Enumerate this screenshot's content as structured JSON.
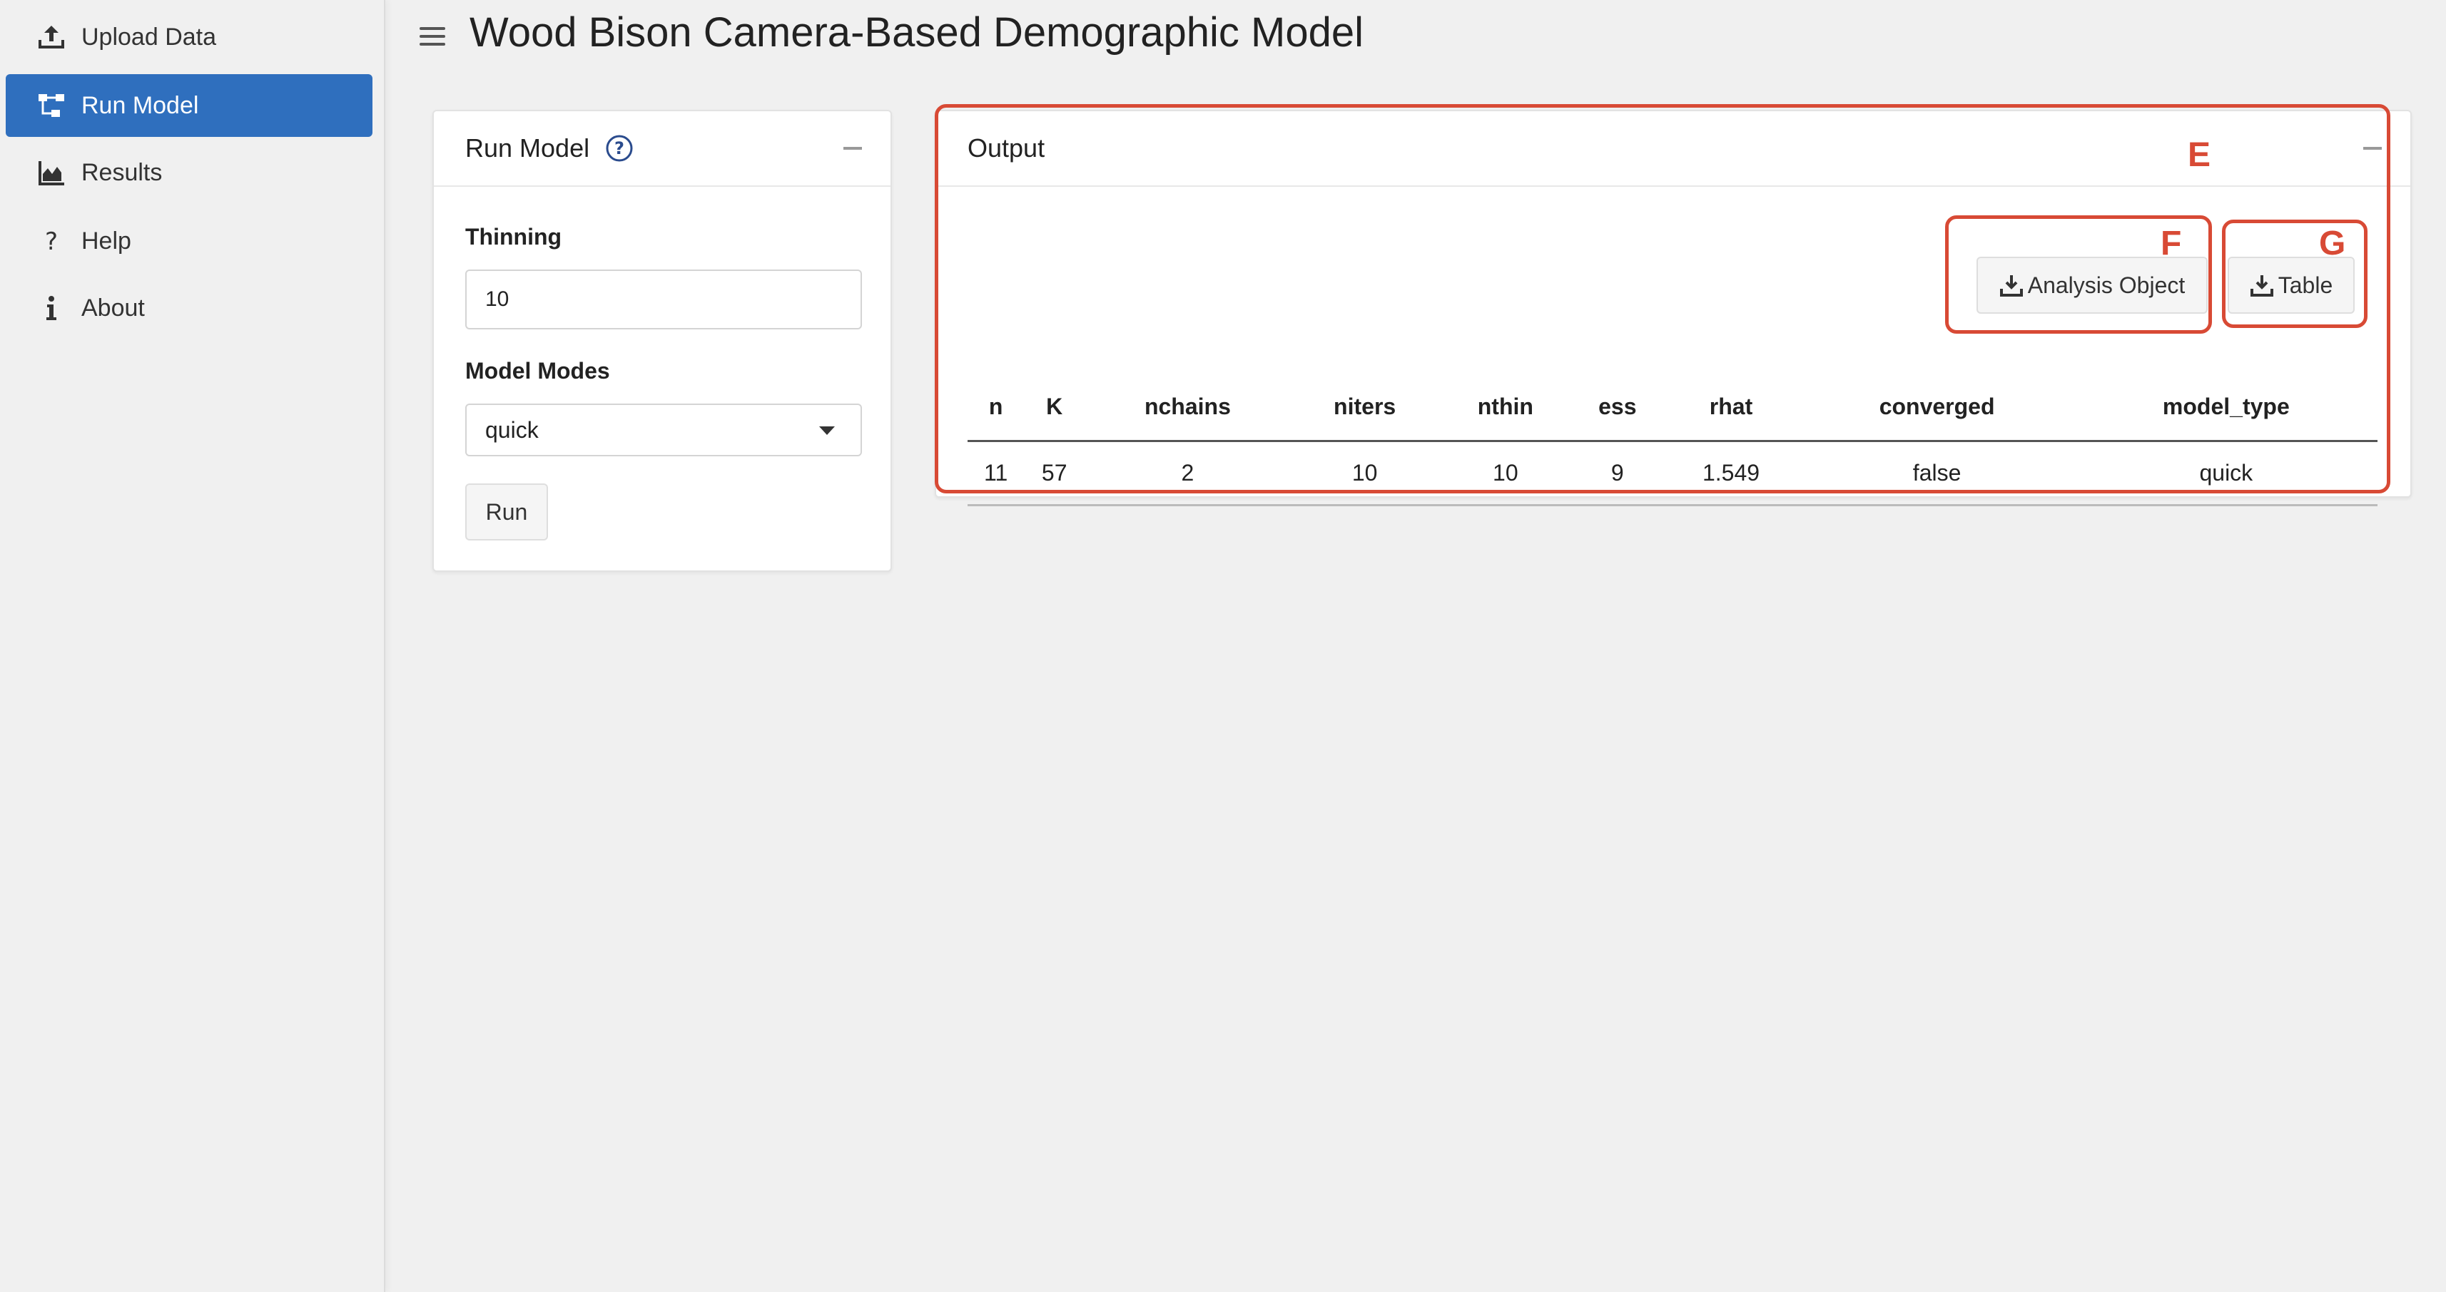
{
  "app": {
    "title": "Wood Bison Camera-Based Demographic Model"
  },
  "sidebar": {
    "items": [
      {
        "label": "Upload Data",
        "icon": "upload-icon",
        "active": false
      },
      {
        "label": "Run Model",
        "icon": "sitemap-icon",
        "active": true
      },
      {
        "label": "Results",
        "icon": "area-chart-icon",
        "active": false
      },
      {
        "label": "Help",
        "icon": "question-icon",
        "active": false
      },
      {
        "label": "About",
        "icon": "info-icon",
        "active": false
      }
    ]
  },
  "run_model": {
    "title": "Run Model",
    "thinning_label": "Thinning",
    "thinning_value": "10",
    "model_modes_label": "Model Modes",
    "model_modes_value": "quick",
    "run_label": "Run"
  },
  "output": {
    "title": "Output",
    "analysis_object_label": "Analysis Object",
    "table_label": "Table",
    "columns": [
      "n",
      "K",
      "nchains",
      "niters",
      "nthin",
      "ess",
      "rhat",
      "converged",
      "model_type"
    ],
    "rows": [
      [
        "11",
        "57",
        "2",
        "10",
        "10",
        "9",
        "1.549",
        "false",
        "quick"
      ]
    ]
  },
  "annotations": {
    "E": "E",
    "F": "F",
    "G": "G"
  },
  "colors": {
    "accent": "#2f6fbe",
    "annotation": "#d84a35",
    "background": "#f0f0f0"
  }
}
